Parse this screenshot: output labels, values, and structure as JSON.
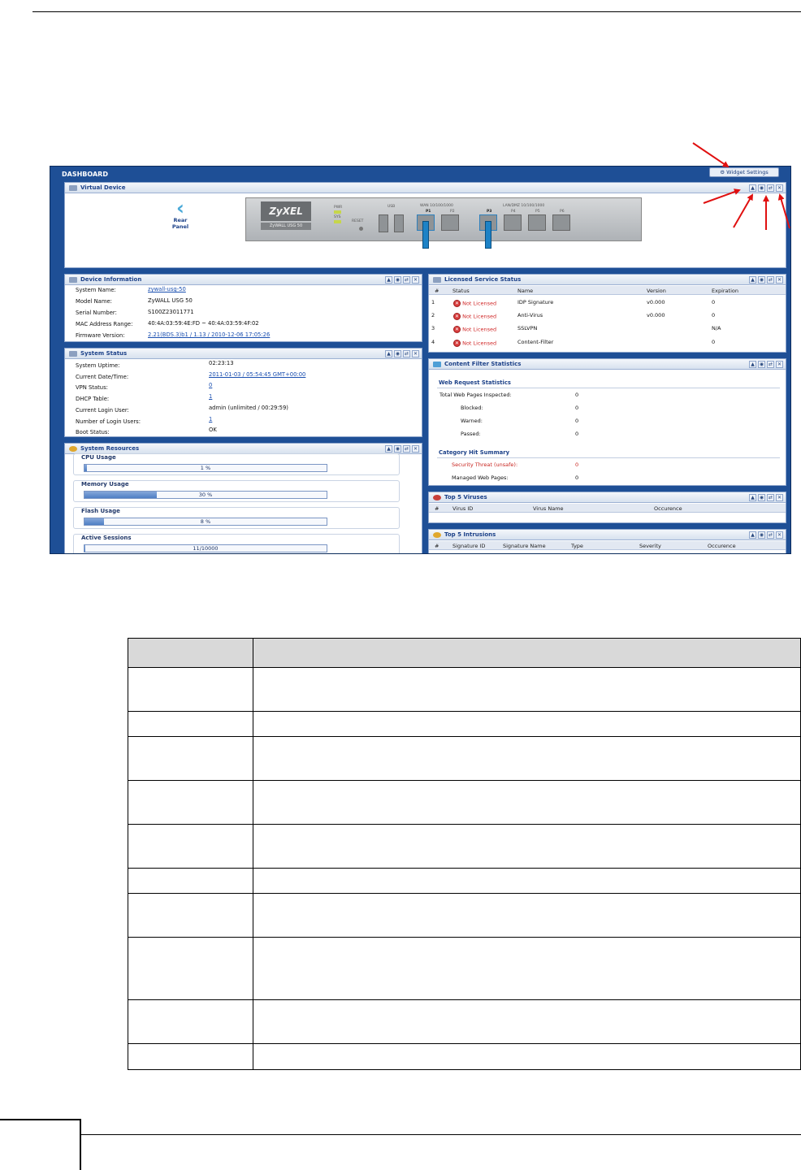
{
  "dashboard": {
    "title": "DASHBOARD",
    "widget_settings_label": "Widget Settings"
  },
  "virtual_device": {
    "title": "Virtual Device",
    "rear_panel_label": "Rear Panel",
    "brand": "ZyXEL",
    "model": "ZyWALL USG 50",
    "led_pwr": "PWR",
    "led_sys": "SYS",
    "reset_label": "RESET",
    "usb_label": "USB",
    "wan_label": "WAN 10/100/1000",
    "lan_label": "LAN/DMZ 10/100/1000",
    "port_p1": "P1",
    "port_p2": "P2",
    "port_p3": "P3",
    "port_p4": "P4",
    "port_p5": "P5",
    "port_p6": "P6"
  },
  "device_information": {
    "title": "Device Information",
    "rows": [
      {
        "key": "System Name:",
        "value": "zywall-usg-50"
      },
      {
        "key": "Model Name:",
        "value": "ZyWALL USG 50"
      },
      {
        "key": "Serial Number:",
        "value": "S100Z23011771"
      },
      {
        "key": "MAC Address Range:",
        "value": "40:4A:03:59:4E:FD ~ 40:4A:03:59:4F:02"
      },
      {
        "key": "Firmware Version:",
        "value": "2.21(BDS.3)b1 / 1.13 / 2010-12-06 17:05:26"
      }
    ]
  },
  "system_status": {
    "title": "System Status",
    "rows": [
      {
        "key": "System Uptime:",
        "value": "02:23:13"
      },
      {
        "key": "Current Date/Time:",
        "value": "2011-01-03 / 05:54:45 GMT+00:00"
      },
      {
        "key": "VPN Status:",
        "value": "0"
      },
      {
        "key": "DHCP Table:",
        "value": "1"
      },
      {
        "key": "Current Login User:",
        "value": "admin (unlimited / 00:29:59)"
      },
      {
        "key": "Number of Login Users:",
        "value": "1"
      },
      {
        "key": "Boot Status:",
        "value": "OK"
      }
    ]
  },
  "system_resources": {
    "title": "System Resources",
    "bars": [
      {
        "label": "CPU Usage",
        "text": "1 %",
        "fraction": 0.01
      },
      {
        "label": "Memory Usage",
        "text": "30 %",
        "fraction": 0.3
      },
      {
        "label": "Flash Usage",
        "text": "8 %",
        "fraction": 0.08
      },
      {
        "label": "Active Sessions",
        "text": "11/10000",
        "fraction": 0.0011
      }
    ]
  },
  "licensed_service_status": {
    "title": "Licensed Service Status",
    "headers": [
      "#",
      "Status",
      "Name",
      "Version",
      "Expiration"
    ],
    "rows": [
      {
        "num": "1",
        "status": "Not Licensed",
        "name": "IDP Signature",
        "version": "v0.000",
        "expiration": "0"
      },
      {
        "num": "2",
        "status": "Not Licensed",
        "name": "Anti-Virus",
        "version": "v0.000",
        "expiration": "0"
      },
      {
        "num": "3",
        "status": "Not Licensed",
        "name": "SSLVPN",
        "version": "",
        "expiration": "N/A"
      },
      {
        "num": "4",
        "status": "Not Licensed",
        "name": "Content-Filter",
        "version": "",
        "expiration": "0"
      }
    ]
  },
  "content_filter": {
    "title": "Content Filter Statistics",
    "web_request_heading": "Web Request Statistics",
    "total_label": "Total Web Pages Inspected:",
    "total_value": "0",
    "blocked_label": "Blocked:",
    "blocked_value": "0",
    "warned_label": "Warned:",
    "warned_value": "0",
    "passed_label": "Passed:",
    "passed_value": "0",
    "category_heading": "Category Hit Summary",
    "threat_label": "Security Threat (unsafe):",
    "threat_value": "0",
    "managed_label": "Managed Web Pages:",
    "managed_value": "0"
  },
  "top_viruses": {
    "title": "Top 5 Viruses",
    "headers": [
      "#",
      "Virus ID",
      "Virus Name",
      "Occurence"
    ]
  },
  "top_intrusions": {
    "title": "Top 5 Intrusions",
    "headers": [
      "#",
      "Signature ID",
      "Signature Name",
      "Type",
      "Severity",
      "Occurence"
    ]
  },
  "colors": {
    "dashboard_bg": "#1e4f96",
    "panel_title": "#1d4289",
    "not_licensed": "#d12b2b",
    "arrow": "#e01010"
  }
}
